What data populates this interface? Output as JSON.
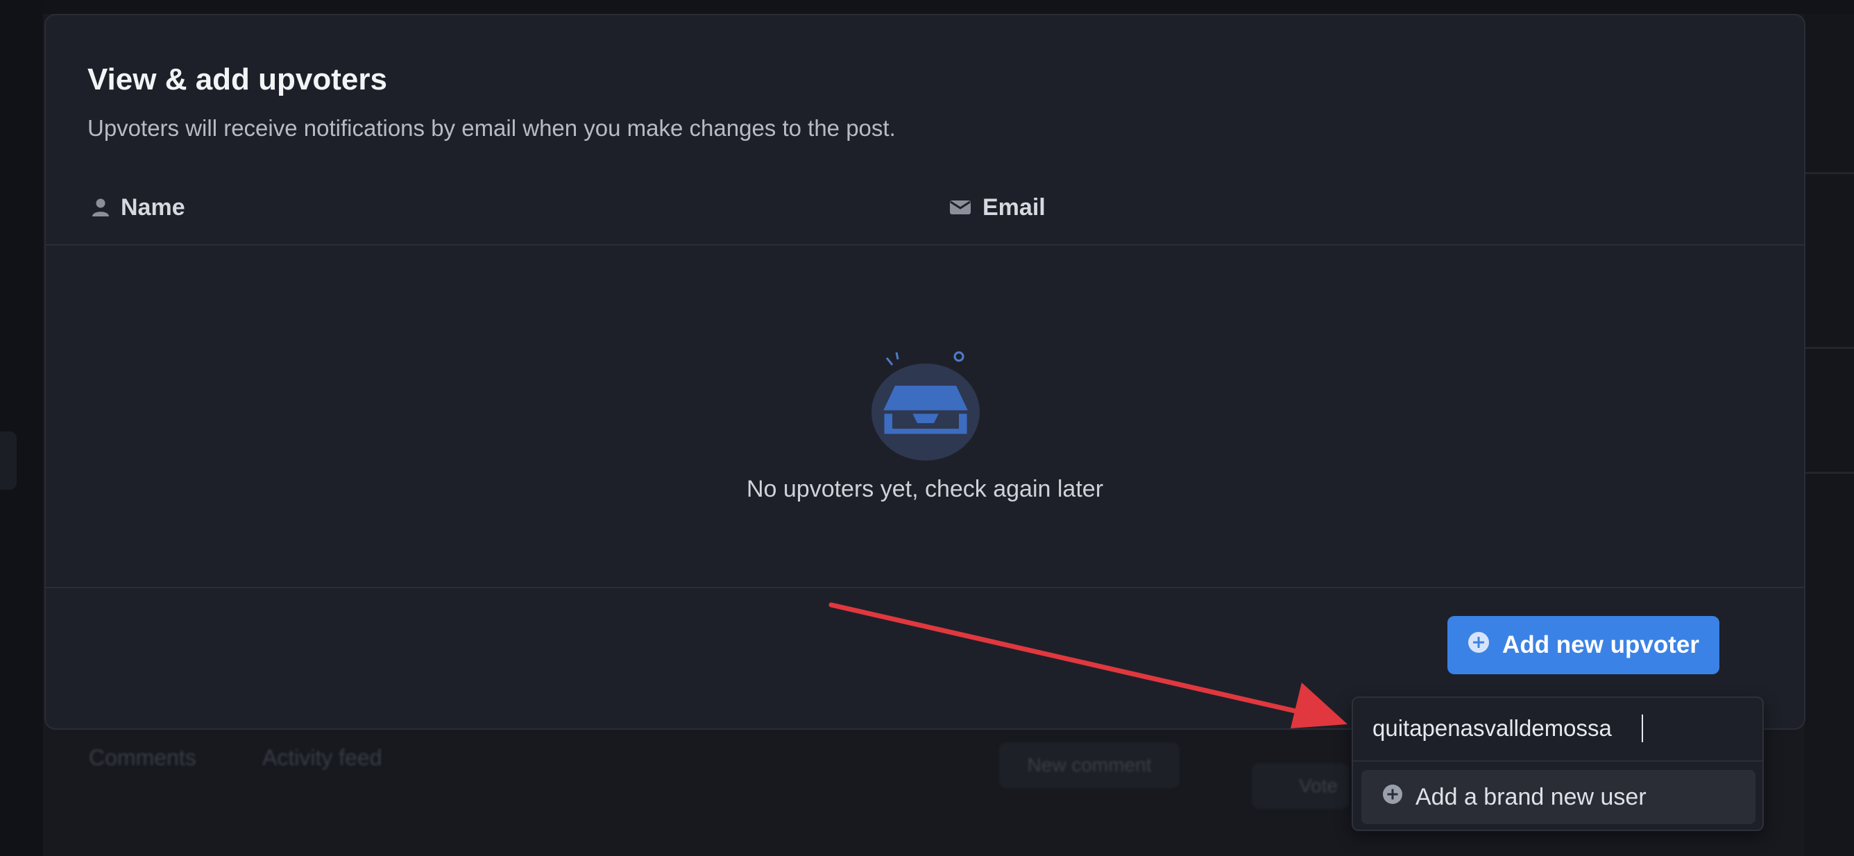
{
  "modal": {
    "title": "View & add upvoters",
    "subtitle": "Upvoters will receive notifications by email when you make changes to the post.",
    "columns": {
      "name": "Name",
      "email": "Email"
    },
    "empty_state": "No upvoters yet, check again later",
    "add_button": "Add new upvoter"
  },
  "dropdown": {
    "search_value": "quitapenasvalldemossa",
    "option_label": "Add a brand new user"
  },
  "background": {
    "tabs": [
      "Comments",
      "Activity feed"
    ],
    "buttons": [
      "New comment",
      "Vote"
    ]
  },
  "colors": {
    "accent": "#3b82e6",
    "annotation_arrow": "#e0383e",
    "modal_bg": "#1e2029"
  },
  "icons": [
    "user-icon",
    "mail-icon",
    "empty-inbox-icon",
    "plus-circle-icon",
    "arrow-annotation"
  ]
}
